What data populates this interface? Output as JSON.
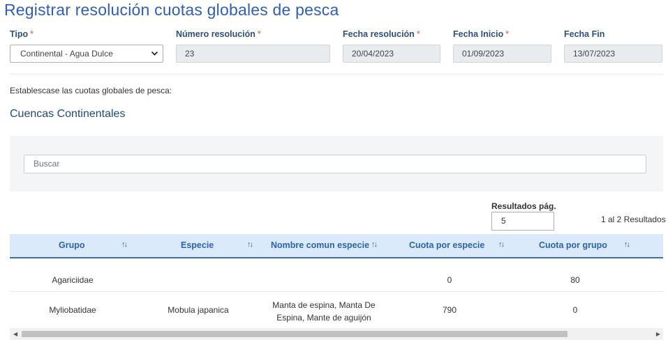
{
  "page": {
    "title": "Registrar resolución cuotas globales de pesca"
  },
  "form": {
    "tipo": {
      "label": "Tipo",
      "value": "Continental - Agua Dulce"
    },
    "numero_resolucion": {
      "label": "Número resolución",
      "value": "23"
    },
    "fecha_resolucion": {
      "label": "Fecha resolución",
      "value": "20/04/2023"
    },
    "fecha_inicio": {
      "label": "Fecha Inicio",
      "value": "01/09/2023"
    },
    "fecha_fin": {
      "label": "Fecha Fin",
      "value": "13/07/2023"
    },
    "required_mark": "*"
  },
  "intro_text": "Establescase las cuotas globales de pesca:",
  "section_title": "Cuencas Continentales",
  "search": {
    "placeholder": "Buscar"
  },
  "pagination": {
    "label": "Resultados pág.",
    "value": "5",
    "summary": "1 al 2 Resultados"
  },
  "table": {
    "sort_icon": "↑↓",
    "columns": [
      "Grupo",
      "Especie",
      "Nombre comun especie",
      "Cuota por especie",
      "Cuota por grupo"
    ],
    "rows": [
      {
        "grupo": "Agariciidae",
        "especie": "",
        "nombre_line1": "",
        "nombre_line2": "",
        "cuota_especie": "0",
        "cuota_grupo": "80"
      },
      {
        "grupo": "Myliobatidae",
        "especie": "Mobula japanica",
        "nombre_line1": "Manta de espina, Manta De",
        "nombre_line2": "Espina, Mante de aguijón",
        "cuota_especie": "790",
        "cuota_grupo": "0"
      }
    ]
  },
  "icons": {
    "dropdown": "chevron-down-icon",
    "sort": "sort-icon",
    "scroll_left": "arrow-left-icon",
    "scroll_right": "arrow-right-icon"
  }
}
